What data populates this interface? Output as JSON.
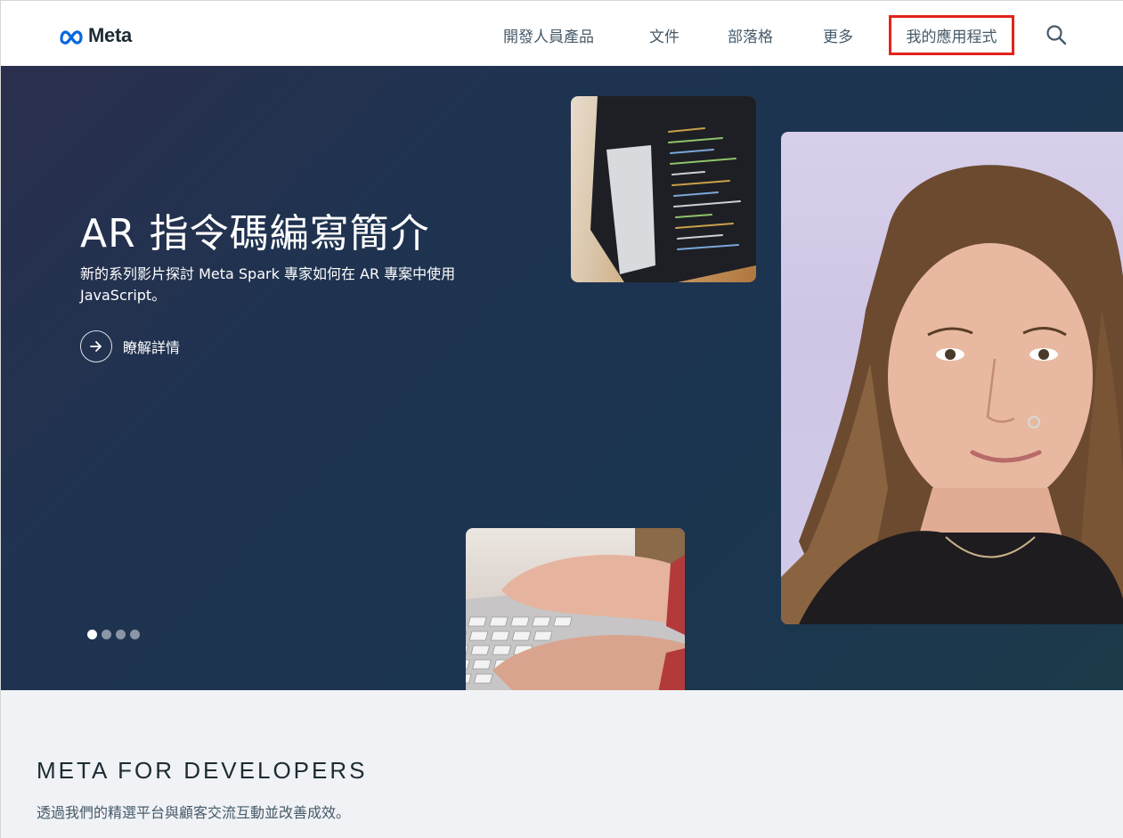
{
  "header": {
    "logo_text": "Meta",
    "nav": {
      "products": "開發人員產品",
      "docs": "文件",
      "blog": "部落格",
      "more": "更多",
      "my_apps": "我的應用程式"
    }
  },
  "hero": {
    "title": "AR 指令碼編寫簡介",
    "description": "新的系列影片探討 Meta Spark 專家如何在 AR 專案中使用 JavaScript。",
    "learn_more": "瞭解詳情",
    "carousel": {
      "total_slides": 4,
      "active_slide": 1
    }
  },
  "section": {
    "heading": "META FOR DEVELOPERS",
    "subtitle": "透過我們的精選平台與顧客交流互動並改善成效。"
  },
  "colors": {
    "highlight_box": "#e2231a",
    "meta_blue": "#0668e1",
    "nav_text": "#465a69",
    "hero_bg": "#1b3450",
    "section_bg": "#f0f2f5"
  }
}
